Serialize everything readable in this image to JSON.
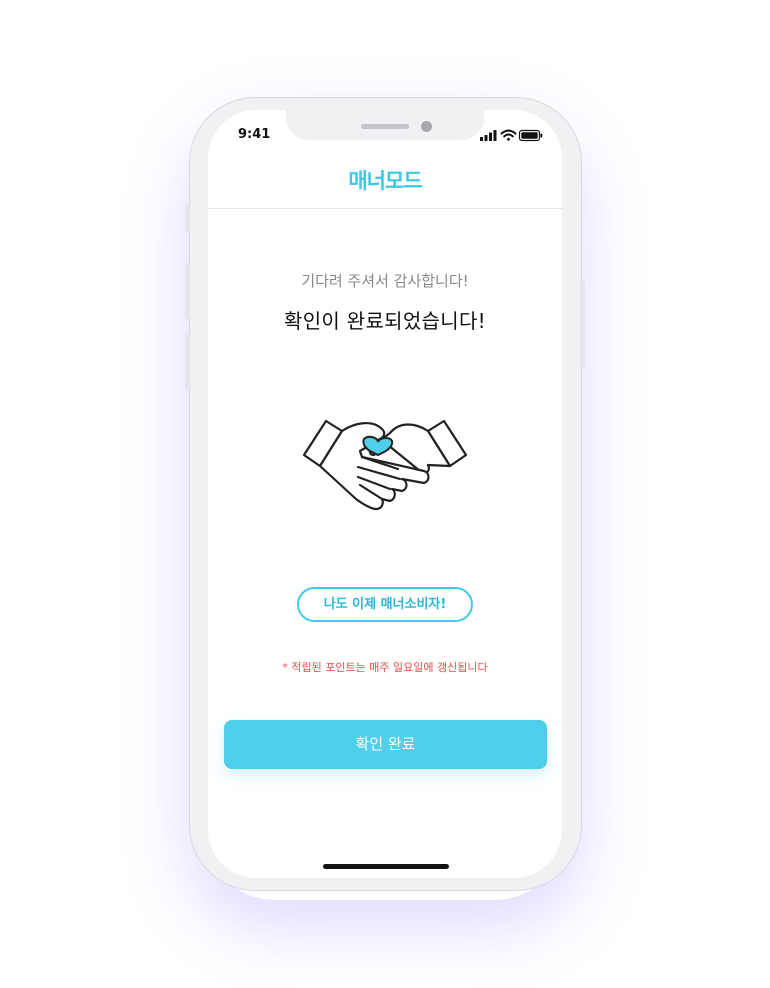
{
  "status_bar": {
    "time": "9:41",
    "signal_icon": "signal-bars-icon",
    "wifi_icon": "wifi-icon",
    "battery_icon": "battery-icon"
  },
  "header": {
    "logo_text": "매너모드"
  },
  "main": {
    "subtitle": "기다려 주셔서 감사합니다!",
    "title": "확인이 완료되었습니다!",
    "illustration_icon": "handshake-icon",
    "badge_label": "나도 이제 매너소비자!",
    "notice": "* 적립된 포인트는 매주 일요일에 갱신됩니다"
  },
  "actions": {
    "confirm_label": "확인 완료"
  },
  "colors": {
    "accent": "#4fd0ea",
    "brand": "#3cc7e5",
    "warning": "#f04a4a",
    "title_text": "#111111",
    "subtitle_text": "#8a8a8a"
  }
}
